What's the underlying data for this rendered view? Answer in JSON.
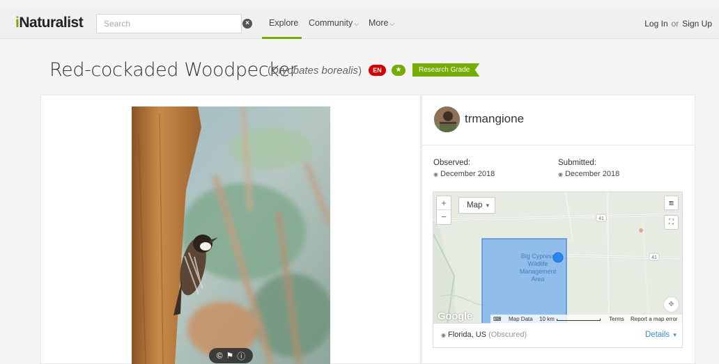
{
  "nav": {
    "logo_prefix": "i",
    "logo_rest": "Naturalist",
    "search_placeholder": "Search",
    "clear_icon": "×",
    "explore": "Explore",
    "community": "Community",
    "more": "More",
    "login": "Log In",
    "or": "or",
    "signup": "Sign Up",
    "accent_color": "#74ac00"
  },
  "observation": {
    "common_name": "Red-cockaded Woodpecker",
    "scientific_name": "Dryobates borealis",
    "iucn_status": "EN",
    "research_grade_label": "Research Grade"
  },
  "user": {
    "username": "trmangione"
  },
  "dates": {
    "observed_label": "Observed:",
    "observed_value": "December 2018",
    "submitted_label": "Submitted:",
    "submitted_value": "December 2018"
  },
  "map": {
    "type_label": "Map",
    "zoom_in": "+",
    "zoom_out": "−",
    "area_label_1": "Big Cypress",
    "area_label_2": "Wildlife",
    "area_label_3": "Management",
    "area_label_4": "Area",
    "road_41": "41",
    "provider": "Google",
    "map_data": "Map Data",
    "scale": "10 km",
    "terms": "Terms",
    "report": "Report a map error",
    "location": "Florida, US",
    "obscured": "(Obscured)",
    "details": "Details"
  }
}
